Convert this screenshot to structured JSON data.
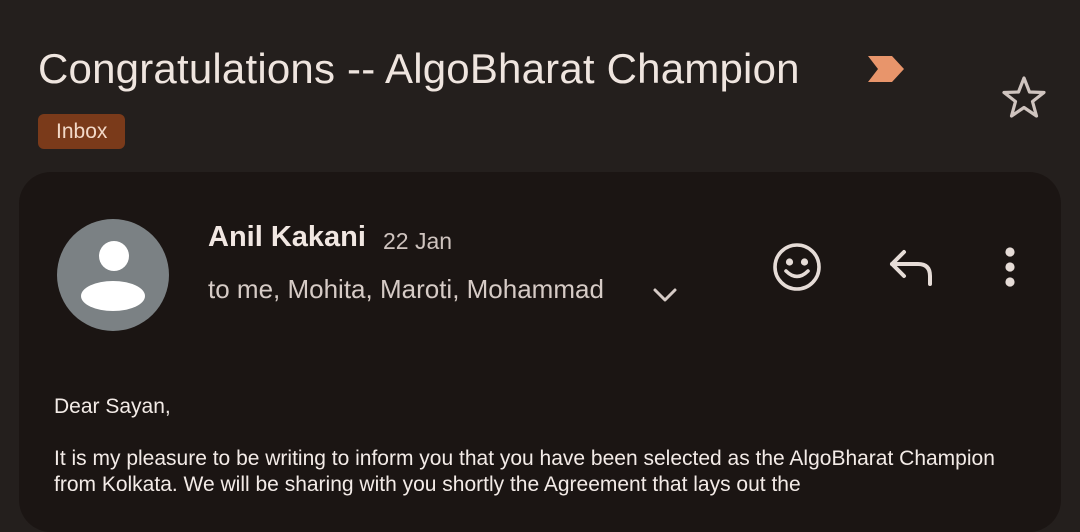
{
  "email": {
    "subject": "Congratulations -- AlgoBharat Champion",
    "label": "Inbox",
    "sender_name": "Anil Kakani",
    "date": "22 Jan",
    "recipients": "to me, Mohita, Maroti, Mohammad",
    "greeting": "Dear Sayan,",
    "body_paragraph": "It is my pleasure to be writing to inform you that you have been selected as the AlgoBharat Champion from Kolkata.  We will be sharing with you shortly the Agreement that lays out the"
  },
  "icons": {
    "important": "important-marker-icon",
    "star": "star-outline-icon",
    "avatar": "person-avatar-icon",
    "expand": "chevron-down-icon",
    "emoji": "emoji-reaction-icon",
    "reply": "reply-icon",
    "more": "more-vert-icon"
  },
  "colors": {
    "background": "#241f1d",
    "card": "#1b1513",
    "label_chip": "#7a3a1a",
    "important_marker": "#e8956b",
    "avatar": "#7b8184"
  }
}
